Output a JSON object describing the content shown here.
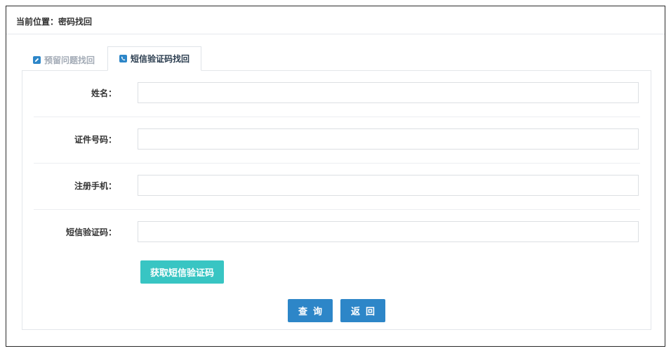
{
  "breadcrumb": {
    "text": "当前位置：密码找回"
  },
  "tabs": [
    {
      "label": "预留问题找回",
      "icon": "edit-icon",
      "active": false
    },
    {
      "label": "短信验证码找回",
      "icon": "phone-icon",
      "active": true
    }
  ],
  "form": {
    "fields": [
      {
        "label": "姓名：",
        "value": "",
        "placeholder": ""
      },
      {
        "label": "证件号码：",
        "value": "",
        "placeholder": ""
      },
      {
        "label": "注册手机：",
        "value": "",
        "placeholder": ""
      },
      {
        "label": "短信验证码：",
        "value": "",
        "placeholder": ""
      }
    ],
    "sms_button": "获取短信验证码",
    "query_button": "查询",
    "back_button": "返回"
  },
  "colors": {
    "primary": "#2d86c8",
    "teal": "#38c5c3",
    "border": "#dfe3e8"
  }
}
